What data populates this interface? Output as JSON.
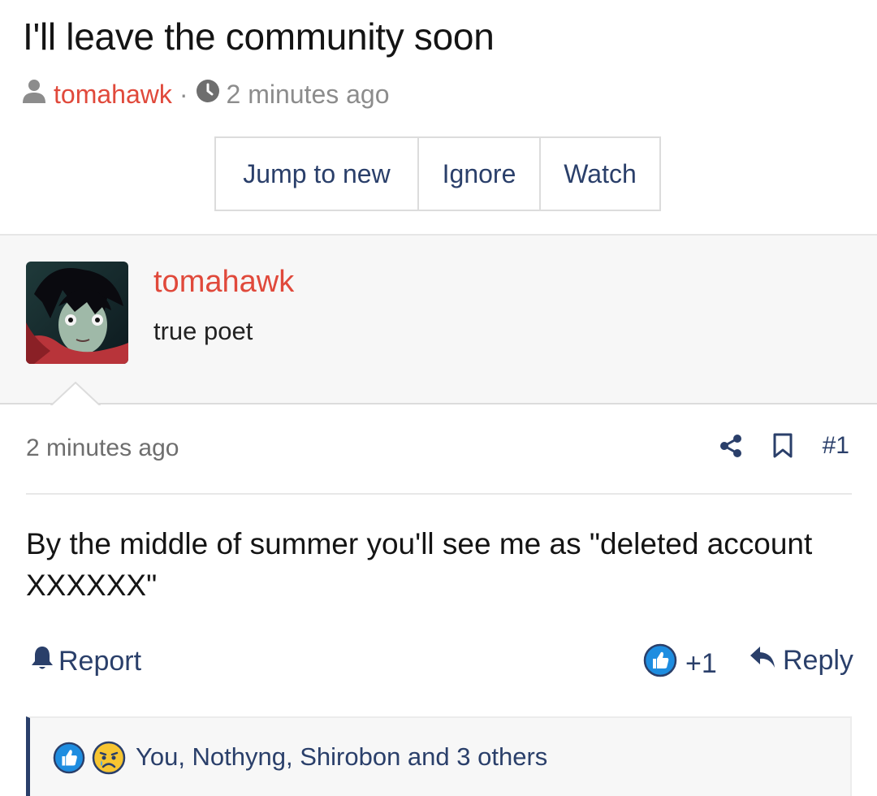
{
  "thread": {
    "title": "I'll leave the community soon",
    "author": "tomahawk",
    "separator": "·",
    "time": "2 minutes ago"
  },
  "actions": {
    "jump_label": "Jump to new",
    "ignore_label": "Ignore",
    "watch_label": "Watch"
  },
  "author_block": {
    "name": "tomahawk",
    "title": "true poet"
  },
  "post": {
    "time": "2 minutes ago",
    "number": "#1",
    "body": "By the middle of summer you'll see me as \"deleted account XXXXXX\"",
    "report_label": "Report",
    "vote_count": "+1",
    "reply_label": "Reply"
  },
  "reactions": {
    "list": "You, Nothyng, Shirobon and 3 others",
    "icons": [
      "thumbs-up-icon",
      "sad-cry-icon"
    ]
  },
  "colors": {
    "accent": "#2a3f6a",
    "author": "#e0493b",
    "like": "#1e8de0",
    "muted": "#8c8c8c"
  }
}
